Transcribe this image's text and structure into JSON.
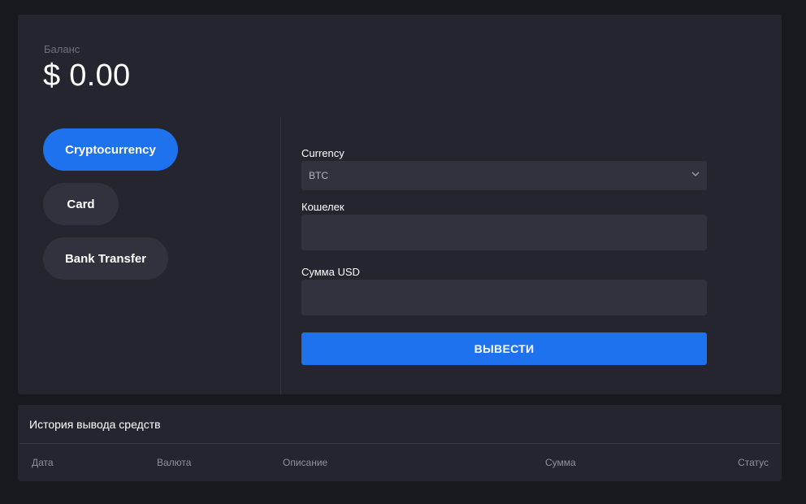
{
  "balance": {
    "label": "Баланс",
    "value": "$ 0.00"
  },
  "methods": [
    {
      "label": "Cryptocurrency",
      "active": true
    },
    {
      "label": "Card",
      "active": false
    },
    {
      "label": "Bank Transfer",
      "active": false
    }
  ],
  "form": {
    "currency_label": "Currency",
    "currency_value": "BTC",
    "wallet_label": "Кошелек",
    "wallet_value": "",
    "amount_label": "Сумма USD",
    "amount_value": "",
    "submit_label": "ВЫВЕСТИ"
  },
  "history": {
    "title": "История вывода средств",
    "columns": [
      "Дата",
      "Валюта",
      "Описание",
      "Сумма",
      "Статус"
    ]
  },
  "colors": {
    "accent": "#1f72ee",
    "background": "#18191f",
    "panel": "#24252f",
    "field": "#31323e"
  },
  "icons": {
    "select_chevron": "chevron-down-icon"
  }
}
